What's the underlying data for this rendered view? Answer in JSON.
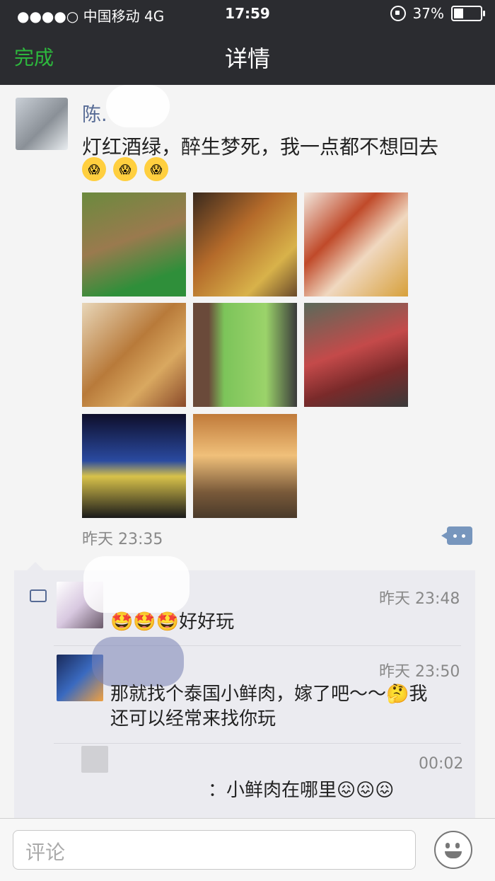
{
  "status": {
    "carrier": "●●●●○ 中国移动  4G",
    "time": "17:59",
    "battery": "37%",
    "battery_level": 0.37
  },
  "nav": {
    "done": "完成",
    "title": "详情"
  },
  "post": {
    "author": "陈.",
    "text": "灯红酒绿，醉生梦死，我一点都不想回去",
    "time": "昨天 23:35",
    "emojis": [
      "😱",
      "😱",
      "😱"
    ]
  },
  "comments": [
    {
      "time": "昨天 23:48",
      "text": "🤩🤩🤩好好玩"
    },
    {
      "time": "昨天 23:50",
      "line1": "那就找个泰国小鲜肉，嫁了吧～～🤔我",
      "line2": "还可以经常来找你玩"
    },
    {
      "time": "00:02",
      "text": "：小鲜肉在哪里😖😖😖"
    }
  ],
  "input": {
    "placeholder": "评论"
  },
  "colors": {
    "nav_bg": "#2b2c30",
    "accent_green": "#2db83d",
    "name_blue": "#576b95"
  }
}
